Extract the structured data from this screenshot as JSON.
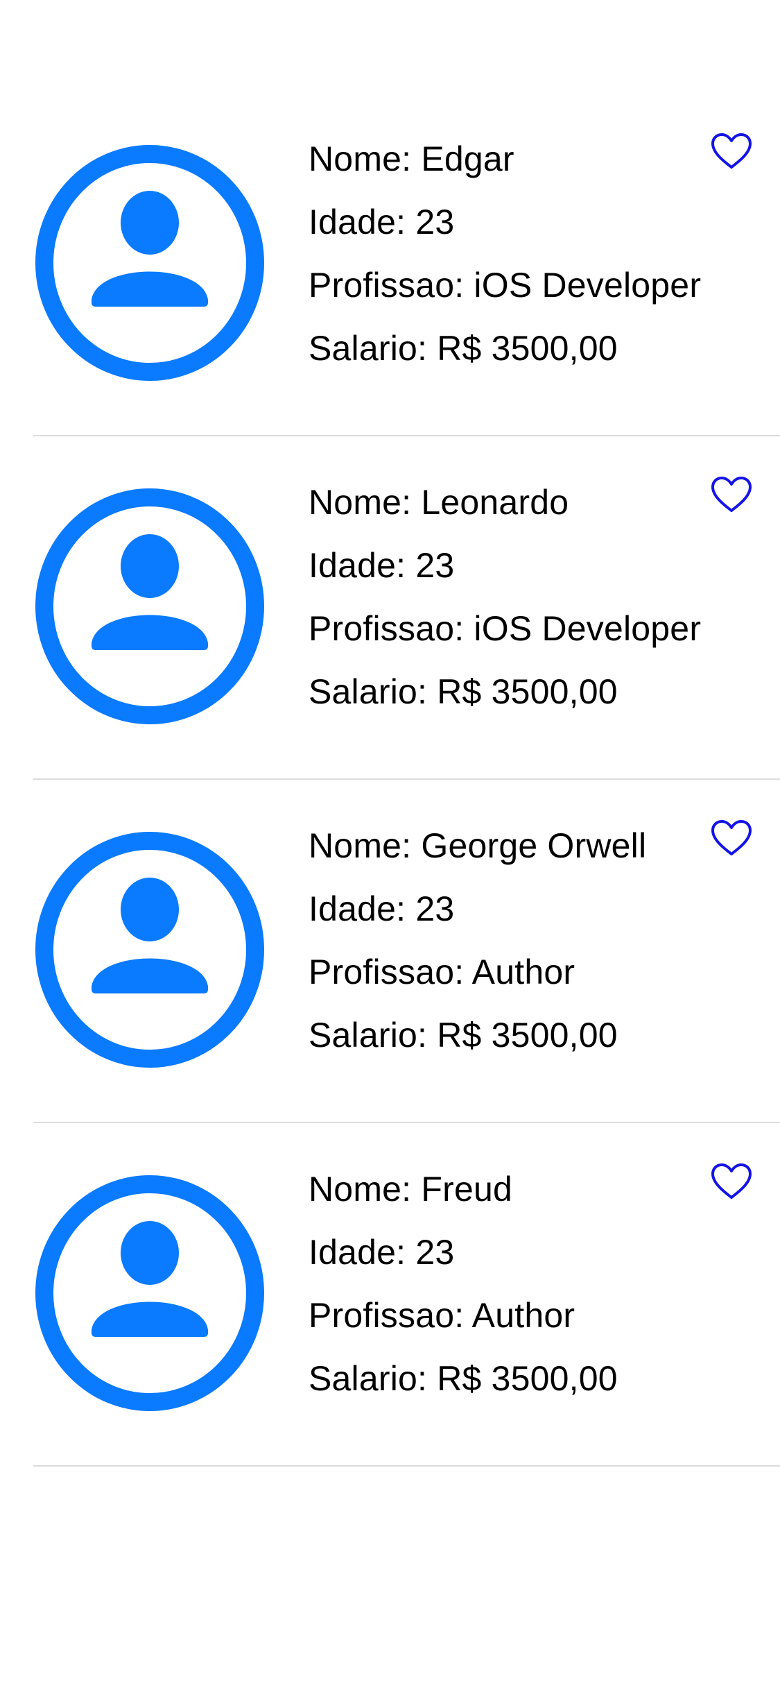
{
  "colors": {
    "avatar": "#0A7AFF",
    "heart": "#1414E6",
    "separator": "#DCDCDC",
    "text": "#000000"
  },
  "icons": {
    "avatar": "person-crop-circle-icon",
    "favorite": "heart-outline-icon"
  },
  "labels": {
    "nome": "Nome:",
    "idade": "Idade:",
    "profissao": "Profissao:",
    "salario": "Salario:"
  },
  "people": [
    {
      "nome": "Edgar",
      "idade": "23",
      "profissao": "iOS Developer",
      "salario": "R$ 3500,00"
    },
    {
      "nome": "Leonardo",
      "idade": "23",
      "profissao": "iOS Developer",
      "salario": "R$ 3500,00"
    },
    {
      "nome": "George Orwell",
      "idade": "23",
      "profissao": "Author",
      "salario": "R$ 3500,00"
    },
    {
      "nome": "Freud",
      "idade": "23",
      "profissao": "Author",
      "salario": "R$ 3500,00"
    }
  ]
}
